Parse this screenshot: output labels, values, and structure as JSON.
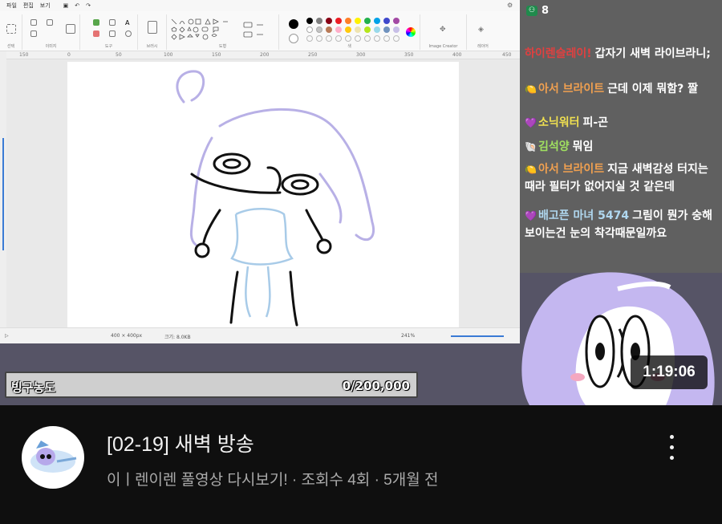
{
  "paint": {
    "menu": [
      "파일",
      "편집",
      "보기"
    ],
    "groups": [
      "선택",
      "이미지",
      "도구",
      "브러시",
      "도형",
      "색",
      "Image Creator",
      "레이어"
    ],
    "ruler_ticks": [
      "150",
      "0",
      "50",
      "100",
      "150",
      "200",
      "250",
      "300",
      "350",
      "400",
      "450"
    ],
    "status_size": "400 × 400px",
    "status_filesize": "크기: 8.0KB",
    "zoom": "241%"
  },
  "chat": {
    "viewer_count": "8",
    "messages": [
      {
        "nick": "하이렌슬레이!",
        "nick_color": "#e04040",
        "text": "갑자기 새벽 라이브라니;",
        "emoji": ""
      },
      {
        "nick": "아서 브라이트",
        "nick_color": "#f0a050",
        "text": "근데 이제 뭐함? 짤",
        "emoji": "🍋"
      },
      {
        "nick": "소닉워터",
        "nick_color": "#f0e050",
        "text": "피-곤",
        "emoji": "💜"
      },
      {
        "nick": "김석양",
        "nick_color": "#a0e060",
        "text": "뭐임",
        "emoji": "🐚"
      },
      {
        "nick": "아서 브라이트",
        "nick_color": "#f0a050",
        "text": "지금 새벽감성 터지는 때라 필터가 없어지실 것 같은데",
        "emoji": "🍋"
      },
      {
        "nick": "배고픈 마녀 5474",
        "nick_color": "#b0d8f0",
        "text": "그림이 뭔가 숭해보이는건 눈의 착각때문일까요",
        "emoji": "💜"
      }
    ]
  },
  "gauge": {
    "label": "빙구농도",
    "value": "0/200,000"
  },
  "duration": "1:19:06",
  "video": {
    "title": "[02-19] 새벽 방송",
    "channel": "이ㅣ렌이렌 풀영상 다시보기!",
    "views": "조회수 4회",
    "age": "5개월 전",
    "separator": "·"
  },
  "colors": {
    "accent_red": "#e04040",
    "lavender": "#b7a8e8"
  }
}
